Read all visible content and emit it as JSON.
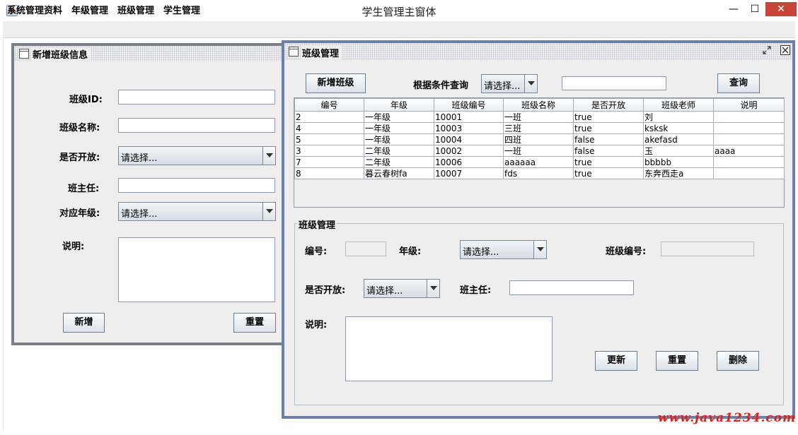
{
  "window": {
    "title": "学生管理主窗体",
    "min_glyph": "—",
    "max_glyph": "☐",
    "close_glyph": "✕"
  },
  "menubar": {
    "items": [
      "系统管理资料",
      "年级管理",
      "班级管理",
      "学生管理"
    ]
  },
  "add_frame": {
    "title": "新增班级信息",
    "fields": {
      "id_label": "班级ID:",
      "name_label": "班级名称:",
      "open_label": "是否开放:",
      "open_value": "请选择...",
      "teacher_label": "班主任:",
      "grade_label": "对应年级:",
      "grade_value": "请选择...",
      "note_label": "说明:"
    },
    "buttons": {
      "add": "新增",
      "reset": "重置"
    }
  },
  "class_frame": {
    "title": "班级管理",
    "toolbar": {
      "add_button": "新增班级",
      "query_label": "根据条件查询",
      "condition_value": "请选择...",
      "query_input": "",
      "query_button": "查询"
    },
    "table": {
      "columns": [
        "编号",
        "年级",
        "班级编号",
        "班级名称",
        "是否开放",
        "班级老师",
        "说明"
      ],
      "rows": [
        [
          "2",
          "一年级",
          "10001",
          "一班",
          "true",
          "刘",
          ""
        ],
        [
          "4",
          "一年级",
          "10003",
          "三班",
          "true",
          "ksksk",
          ""
        ],
        [
          "5",
          "一年级",
          "10004",
          "四班",
          "false",
          "akefasd",
          ""
        ],
        [
          "3",
          "二年级",
          "10002",
          "一班",
          "false",
          "玉",
          "aaaa"
        ],
        [
          "7",
          "二年级",
          "10006",
          "aaaaaa",
          "true",
          "bbbbb",
          ""
        ],
        [
          "8",
          "暮云春树fa",
          "10007",
          "fds",
          "true",
          "东奔西走a",
          ""
        ]
      ]
    },
    "panel": {
      "title": "班级管理",
      "id_label": "编号:",
      "grade_label": "年级:",
      "grade_value": "请选择...",
      "class_no_label": "班级编号:",
      "open_label": "是否开放:",
      "open_value": "请选择...",
      "teacher_label": "班主任:",
      "note_label": "说明:",
      "buttons": {
        "update": "更新",
        "reset": "重置",
        "delete": "删除"
      }
    }
  },
  "watermark": "www.java1234.com",
  "colors": {
    "left_frame_border": "#7a7f87",
    "right_frame_border": "#6e7fab",
    "close_button": "#c7453b",
    "watermark": "#e0201a"
  }
}
